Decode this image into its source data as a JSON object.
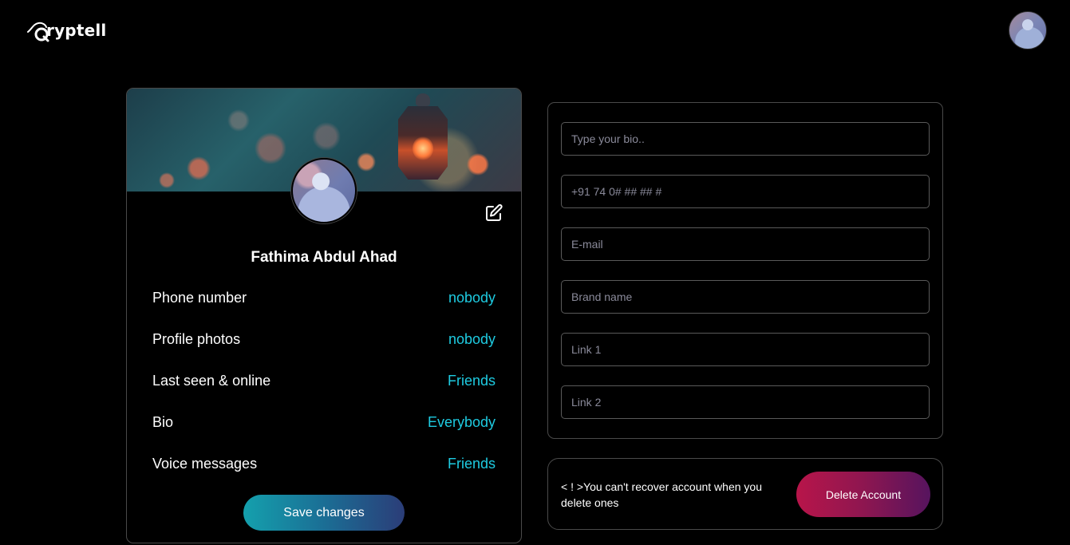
{
  "header": {
    "logo_text": "ryptell",
    "logo_icon": "swoosh-q-logo-icon",
    "avatar_icon": "user-avatar"
  },
  "profile": {
    "name": "Fathima Abdul Ahad",
    "edit_icon": "edit-pencil-icon",
    "privacy": [
      {
        "label": "Phone number",
        "value": "nobody"
      },
      {
        "label": "Profile photos",
        "value": "nobody"
      },
      {
        "label": "Last seen & online",
        "value": "Friends"
      },
      {
        "label": "Bio",
        "value": "Everybody"
      },
      {
        "label": "Voice messages",
        "value": "Friends"
      }
    ],
    "save_label": "Save changes"
  },
  "form": {
    "bio_placeholder": "Type your bio..",
    "phone_placeholder": "+91 74 0# ## ## #",
    "email_placeholder": "E-mail",
    "brand_placeholder": "Brand name",
    "link1_placeholder": "Link 1",
    "link2_placeholder": "Link 2"
  },
  "danger": {
    "warning": "< ! >You can't recover account when you delete ones",
    "delete_label": "Delete Account"
  },
  "colors": {
    "accent": "#1ecbe1",
    "background": "#000000",
    "save_gradient": [
      "#14a0ad",
      "#2b3d78"
    ],
    "delete_gradient": [
      "#b8154a",
      "#56145e"
    ]
  }
}
